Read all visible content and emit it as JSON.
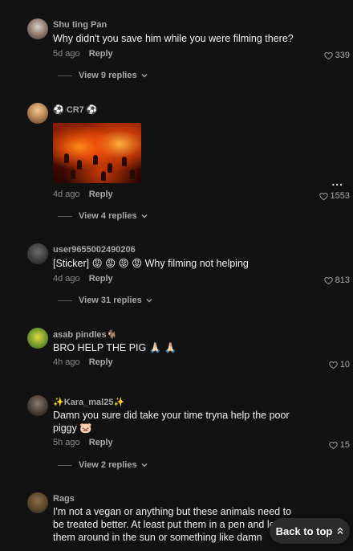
{
  "comments": [
    {
      "username": "Shu ting Pan",
      "text": "Why didn't you save him while you were filming there?",
      "time": "5d ago",
      "reply": "Reply",
      "likes": "339",
      "view_replies": "View 9 replies"
    },
    {
      "username": "⚽ CR7 ⚽",
      "time": "4d ago",
      "reply": "Reply",
      "likes": "1553",
      "more": "...",
      "view_replies": "View 4 replies"
    },
    {
      "username": "user9655002490206",
      "text": "[Sticker] 😡 😡 😡 😡 Why filming not helping",
      "time": "4d ago",
      "reply": "Reply",
      "likes": "813",
      "view_replies": "View 31 replies"
    },
    {
      "username": "asab pindles🐐",
      "text": "BRO HELP THE PIG 🙏🏻 🙏🏻",
      "time": "4h ago",
      "reply": "Reply",
      "likes": "10"
    },
    {
      "username": "✨Kara_mal25✨",
      "text": "Damn you sure did take your time tryna help the poor piggy 🐷",
      "time": "5h ago",
      "reply": "Reply",
      "likes": "15",
      "view_replies": "View 2 replies"
    },
    {
      "username": "Rags",
      "text": "I'm not a vegan or anything but these animals need to be treated better. At least put them in a pen and let them around in the sun or something like damn"
    }
  ],
  "back_to_top": "Back to top",
  "colors": {
    "background": "#121212",
    "text_primary": "#ffffff",
    "text_secondary": "#a8a8a8"
  }
}
